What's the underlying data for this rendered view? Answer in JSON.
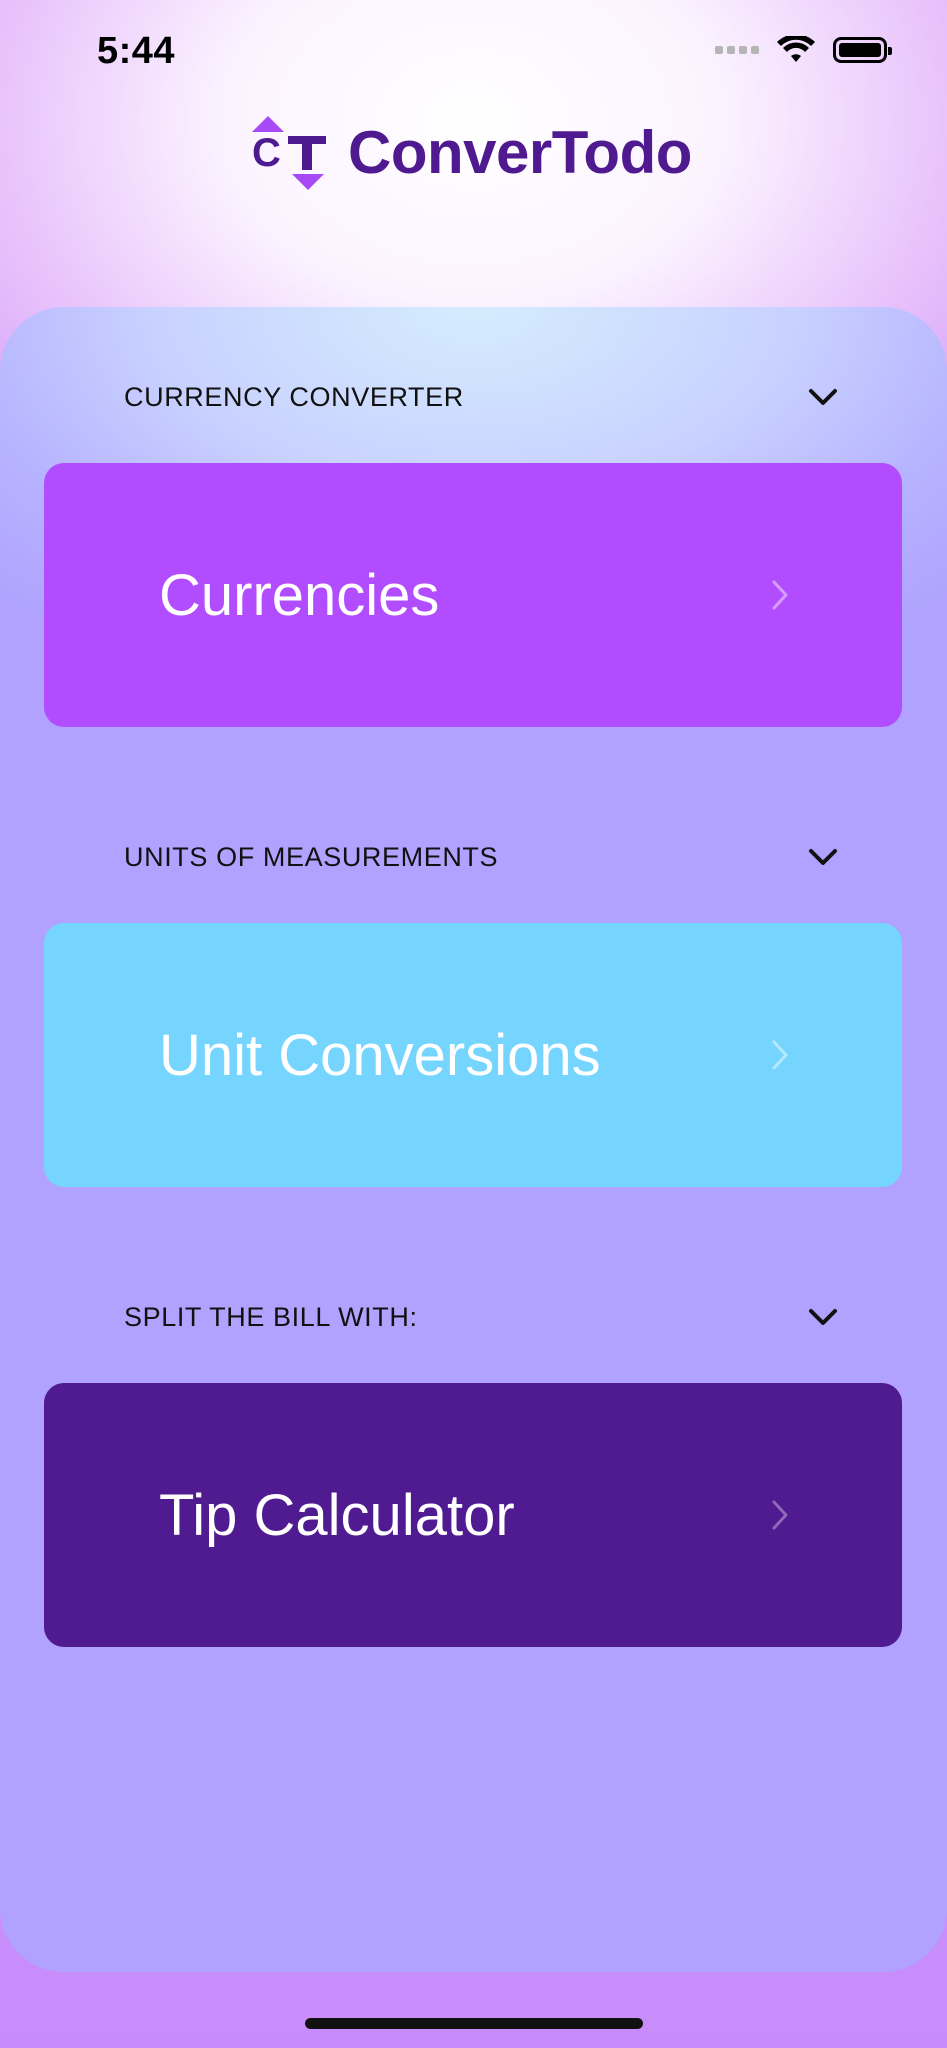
{
  "status_bar": {
    "time": "5:44"
  },
  "app": {
    "name": "ConverTodo",
    "logo_letters": "CT"
  },
  "sections": [
    {
      "header": "CURRENCY CONVERTER",
      "tile_label": "Currencies",
      "tile_color": "#b14dfe"
    },
    {
      "header": "UNITS OF MEASUREMENTS",
      "tile_label": "Unit Conversions",
      "tile_color": "#76d5fe"
    },
    {
      "header": "SPLIT THE BILL WITH:",
      "tile_label": "Tip Calculator",
      "tile_color": "#501a90"
    }
  ],
  "icons": {
    "wifi": "wifi-icon",
    "battery": "battery-icon",
    "signal": "cellular-signal-icon",
    "chevron_down": "chevron-down-icon",
    "chevron_right": "chevron-right-icon"
  }
}
